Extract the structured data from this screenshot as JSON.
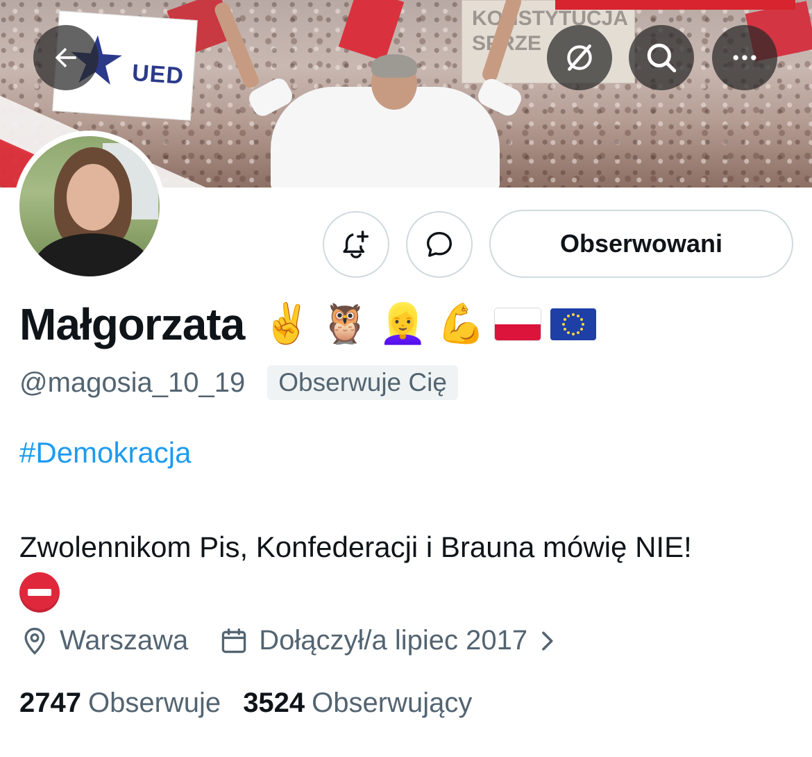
{
  "banner": {
    "sign_ued": "UED",
    "sign_crowd": "KONSTYTUCJA SPRZE"
  },
  "header_buttons": {
    "back_icon": "back-arrow-icon",
    "translate_icon": "grok-icon",
    "search_icon": "search-icon",
    "more_icon": "more-icon"
  },
  "actions": {
    "notify_icon": "bell-plus-icon",
    "message_icon": "message-bubble-icon",
    "follow_label": "Obserwowani"
  },
  "profile": {
    "display_name": "Małgorzata",
    "name_emoji": [
      "✌️",
      "🦉",
      "👱‍♀️",
      "💪"
    ],
    "handle": "@magosia_10_19",
    "follows_you": "Obserwuje Cię",
    "hashtag": "#Demokracja",
    "bio": "Zwolennikom Pis, Konfederacji i Brauna mówię NIE!",
    "location": "Warszawa",
    "joined": "Dołączył/a lipiec 2017",
    "following_count": "2747",
    "following_label": "Obserwuje",
    "followers_count": "3524",
    "followers_label": "Obserwujący"
  },
  "colors": {
    "link": "#1d9bf0",
    "secondary_text": "#536471",
    "primary_text": "#0f1419",
    "border": "#cfd9de"
  }
}
